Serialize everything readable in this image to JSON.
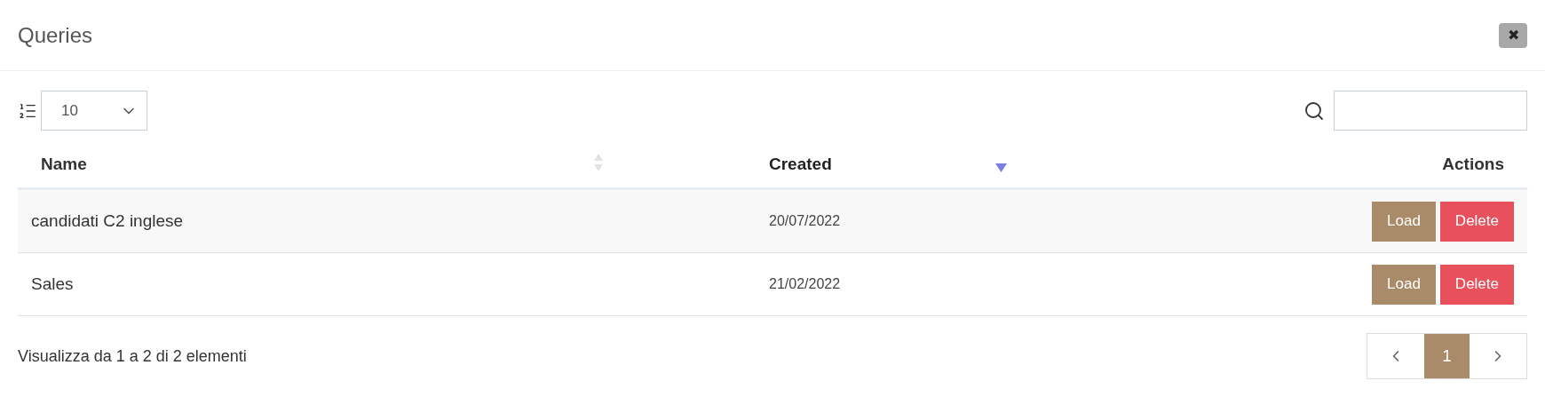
{
  "dialog": {
    "title": "Queries",
    "close_label": "✖"
  },
  "toolbar": {
    "page_size": "10"
  },
  "table": {
    "columns": [
      {
        "label": "Name",
        "sortable": true,
        "sorted": false
      },
      {
        "label": "Created",
        "sortable": true,
        "sorted": true
      },
      {
        "label": "Actions",
        "sortable": false,
        "sorted": false
      }
    ],
    "rows": [
      {
        "name": "candidati C2 inglese",
        "created": "20/07/2022",
        "actions": [
          "Load",
          "Delete"
        ]
      },
      {
        "name": "Sales",
        "created": "21/02/2022",
        "actions": [
          "Load",
          "Delete"
        ]
      }
    ]
  },
  "footer": {
    "info": "Visualizza da 1 a 2 di 2 elementi",
    "pages": [
      {
        "label": "1",
        "selected": true
      }
    ]
  }
}
